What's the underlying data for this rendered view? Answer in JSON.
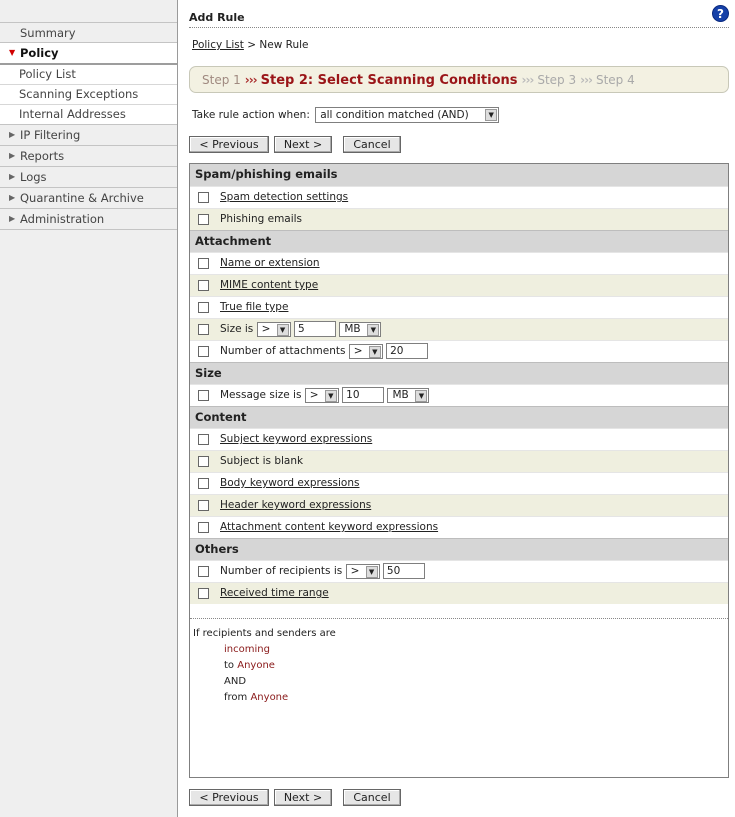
{
  "sidebar": {
    "summary": "Summary",
    "policy": "Policy",
    "policy_sub": [
      "Policy List",
      "Scanning Exceptions",
      "Internal Addresses"
    ],
    "items": [
      "IP Filtering",
      "Reports",
      "Logs",
      "Quarantine & Archive",
      "Administration"
    ]
  },
  "header": {
    "title": "Add Rule",
    "help": "?"
  },
  "breadcrumb": {
    "link": "Policy List",
    "current": " > New Rule"
  },
  "steps": {
    "step1": "Step 1",
    "step2": "Step 2: Select Scanning Conditions",
    "step3": "Step 3",
    "step4": "Step 4",
    "sep": "›››"
  },
  "take_action": {
    "label": "Take rule action when:",
    "value": "all condition matched (AND)"
  },
  "buttons": {
    "previous": "< Previous",
    "next": "Next >",
    "cancel": "Cancel"
  },
  "sections": {
    "spam": {
      "title": "Spam/phishing emails",
      "rows": [
        "Spam detection settings",
        "Phishing emails"
      ]
    },
    "attachment": {
      "title": "Attachment",
      "rows": [
        "Name or extension",
        "MIME content type",
        "True file type"
      ],
      "size_label": "Size is",
      "size_op": ">",
      "size_value": "5",
      "size_unit": "MB",
      "count_label": "Number of attachments",
      "count_op": ">",
      "count_value": "20"
    },
    "size": {
      "title": "Size",
      "label": "Message size is",
      "op": ">",
      "value": "10",
      "unit": "MB"
    },
    "content": {
      "title": "Content",
      "rows": [
        "Subject keyword expressions",
        "Subject is blank",
        "Body keyword expressions",
        "Header keyword expressions",
        "Attachment content keyword expressions"
      ]
    },
    "others": {
      "title": "Others",
      "recip_label": "Number of recipients is",
      "recip_op": ">",
      "recip_value": "50",
      "time_range": "Received time range"
    }
  },
  "recipients": {
    "line1": "If recipients and senders are",
    "direction": "incoming",
    "to": "to",
    "to_value": "Anyone",
    "and": "AND",
    "from": "from",
    "from_value": "Anyone"
  }
}
